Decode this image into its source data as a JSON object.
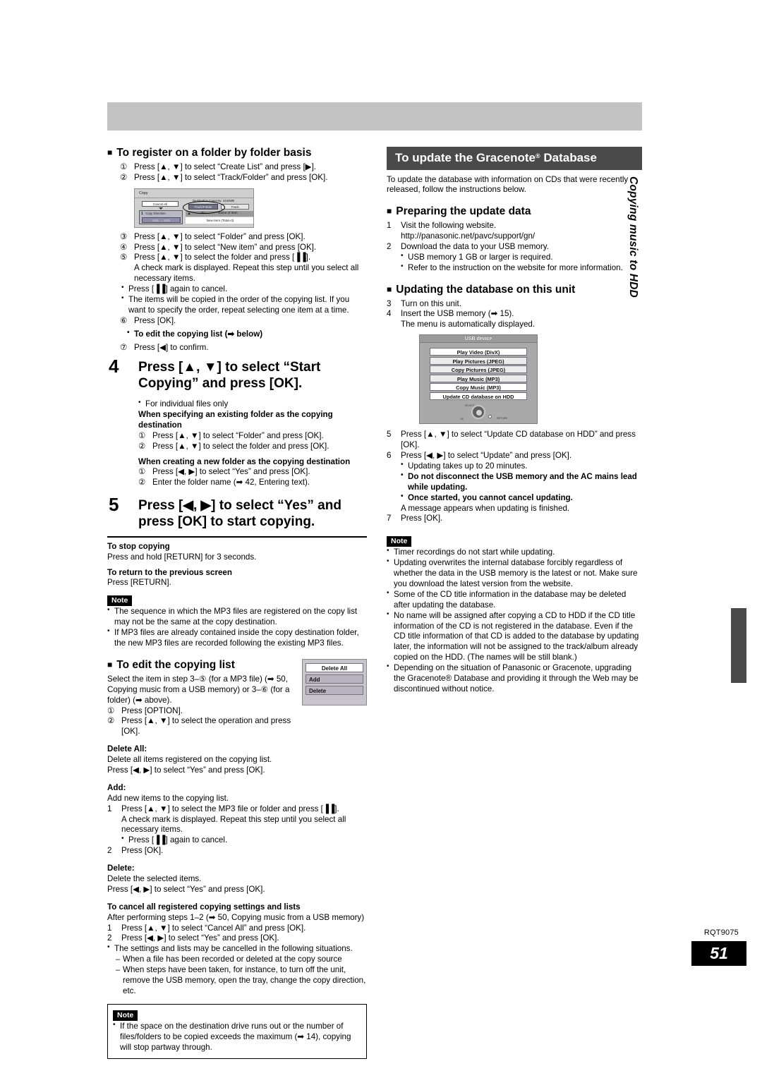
{
  "meta": {
    "doc_number": "RQT9075",
    "page_number": "51",
    "side_tab": "Copying music to HDD"
  },
  "left": {
    "s1_heading": "To register on a folder by folder basis",
    "s1_steps": [
      {
        "mark": "①",
        "text": "Press [▲, ▼] to select “Create List” and press [▶]."
      },
      {
        "mark": "②",
        "text": "Press [▲, ▼] to select “Track/Folder” and press [OK]."
      }
    ],
    "copy_screen": {
      "title": "Copy",
      "cancel_all": "Cancel All",
      "direction_num": "1",
      "direction_label": "Copy Direction",
      "direction_value": "USB → HDD",
      "capacity": "Destination Capacity: 4340MB",
      "tab_trackfolder": "Track/Folder",
      "tab_track": "Track",
      "col_no": "No.",
      "col_name": "Name of Item",
      "row_newitem": "New Item (Total=0)"
    },
    "s1_steps2": [
      {
        "mark": "③",
        "text": "Press [▲, ▼] to select “Folder” and press [OK]."
      },
      {
        "mark": "④",
        "text": "Press [▲, ▼] to select “New item” and press [OK]."
      },
      {
        "mark": "⑤",
        "text": "Press [▲, ▼] to select the folder and press [▐▐]."
      }
    ],
    "s1_note_a": "A check mark is displayed. Repeat this step until you select all necessary items.",
    "s1_bullets": [
      "Press [▐▐] again to cancel.",
      "The items will be copied in the order of the copying list. If you want to specify the order, repeat selecting one item at a time."
    ],
    "s1_step6": {
      "mark": "⑥",
      "text": "Press [OK]."
    },
    "s1_editlink": "To edit the copying list (➡ below)",
    "s1_step7": {
      "mark": "⑦",
      "text": "Press [◀] to confirm."
    },
    "step4_num": "4",
    "step4_text": "Press [▲, ▼] to select “Start Copying” and press [OK].",
    "step4_bullet": "For individual files only",
    "step4_sub1_title": "When specifying an existing folder as the copying destination",
    "step4_sub1_items": [
      {
        "mark": "①",
        "text": "Press [▲, ▼] to select “Folder” and press [OK]."
      },
      {
        "mark": "②",
        "text": "Press [▲, ▼] to select the folder and press [OK]."
      }
    ],
    "step4_sub2_title": "When creating a new folder as the copying destination",
    "step4_sub2_items": [
      {
        "mark": "①",
        "text": "Press [◀, ▶] to select “Yes” and press [OK]."
      },
      {
        "mark": "②",
        "text": "Enter the folder name (➡ 42, Entering text)."
      }
    ],
    "step5_num": "5",
    "step5_text": "Press [◀, ▶] to select “Yes” and press [OK] to start copying.",
    "stop_title": "To stop copying",
    "stop_text": "Press and hold [RETURN] for 3 seconds.",
    "return_title": "To return to the previous screen",
    "return_text": "Press [RETURN].",
    "note_label": "Note",
    "note_bullets": [
      "The sequence in which the MP3 files are registered on the copy list may not be the same at the copy destination.",
      "If MP3 files are already contained inside the copy destination folder, the new MP3 files are recorded following the existing MP3 files."
    ],
    "edit_heading": "To edit the copying list",
    "edit_intro": "Select the item in step 3–⑤ (for a MP3 file) (➡ 50, Copying music from a USB memory) or 3–⑥ (for a folder) (➡ above).",
    "edit_steps": [
      {
        "mark": "①",
        "text": "Press [OPTION]."
      },
      {
        "mark": "②",
        "text": "Press [▲, ▼] to select the operation and press [OK]."
      }
    ],
    "option_menu": {
      "selected": "Delete All",
      "items": [
        "Add",
        "Delete"
      ]
    },
    "deleteall_title": "Delete All:",
    "deleteall_lines": [
      "Delete all items registered on the copying list.",
      "Press [◀, ▶] to select “Yes” and press [OK]."
    ],
    "add_title": "Add:",
    "add_intro": "Add new items to the copying list.",
    "add_steps": [
      {
        "mark": "1",
        "text": "Press [▲, ▼] to select the MP3 file or folder and press [▐▐]."
      },
      {
        "mark": "2",
        "text": "Press [OK]."
      }
    ],
    "add_note": "A check mark is displayed. Repeat this step until you select all necessary items.",
    "add_bullet": "Press [▐▐] again to cancel.",
    "delete_title": "Delete:",
    "delete_lines": [
      "Delete the selected items.",
      "Press [◀, ▶] to select “Yes” and press [OK]."
    ],
    "cancel_title": "To cancel all registered copying settings and lists",
    "cancel_intro": "After performing steps 1–2 (➡ 50, Copying music from a USB memory)",
    "cancel_steps": [
      {
        "mark": "1",
        "text": "Press [▲, ▼] to select “Cancel All” and press [OK]."
      },
      {
        "mark": "2",
        "text": "Press [◀, ▶] to select “Yes” and press [OK]."
      }
    ],
    "cancel_bullet": "The settings and lists may be cancelled in the following situations.",
    "cancel_dashes": [
      "When a file has been recorded or deleted at the copy source",
      "When steps have been taken, for instance, to turn off the unit, remove the USB memory, open the tray, change the copy direction, etc."
    ],
    "note2_label": "Note",
    "note2_bullet": "If the space on the destination drive runs out or the number of files/folders to be copied exceeds the maximum (➡ 14), copying will stop partway through."
  },
  "right": {
    "banner_title": "To update the Gracenote",
    "banner_sup": "®",
    "banner_title2": " Database",
    "intro": "To update the database with information on CDs that were recently released, follow the instructions below.",
    "prep_heading": "Preparing the update data",
    "prep_steps": [
      {
        "mark": "1",
        "text": "Visit the following website."
      },
      {
        "mark": "",
        "text": "http://panasonic.net/pavc/support/gn/"
      },
      {
        "mark": "2",
        "text": "Download the data to your USB memory."
      }
    ],
    "prep_bullets": [
      "USB memory 1 GB or larger is required.",
      "Refer to the instruction on the website for more information."
    ],
    "upd_heading": "Updating the database on this unit",
    "upd_steps": [
      {
        "mark": "3",
        "text": "Turn on this unit."
      },
      {
        "mark": "4",
        "text": "Insert the USB memory (➡ 15)."
      },
      {
        "mark": "",
        "text": "The menu is automatically displayed."
      }
    ],
    "usb_menu": {
      "title": "USB device",
      "items": [
        "Play Video (DivX)",
        "Play Pictures (JPEG)",
        "Copy Pictures (JPEG)",
        "Play Music (MP3)",
        "Copy Music (MP3)",
        "Update CD database on HDD"
      ],
      "pad_select": "SELECT",
      "pad_ok": "OK",
      "pad_return": "RETURN"
    },
    "upd_steps2": [
      {
        "mark": "5",
        "text": "Press [▲, ▼] to select “Update CD database on HDD” and press [OK]."
      },
      {
        "mark": "6",
        "text": "Press [◀, ▶] to select “Update” and press [OK]."
      }
    ],
    "upd_bullets": [
      {
        "text": "Updating takes up to 20 minutes.",
        "bold": false
      },
      {
        "text": "Do not disconnect the USB memory and the AC mains lead while updating.",
        "bold": true
      },
      {
        "text": "Once started, you cannot cancel updating.",
        "bold": true
      }
    ],
    "upd_after": "A message appears when updating is finished.",
    "upd_step7": {
      "mark": "7",
      "text": "Press [OK]."
    },
    "note_label": "Note",
    "note_bullets": [
      "Timer recordings do not start while updating.",
      "Updating overwrites the internal database forcibly regardless of whether the data in the USB memory is the latest or not. Make sure you download the latest version from the website.",
      "Some of the CD title information in the database may be deleted after updating the database.",
      "No name will be assigned after copying a CD to HDD if the CD title information of the CD is not registered in the database. Even if the CD title information of that CD is added to the database by updating later, the information will not be assigned to the track/album already copied on the HDD. (The names will be still blank.)",
      "Depending on the situation of Panasonic or Gracenote, upgrading the Gracenote® Database and providing it through the Web may be discontinued without notice."
    ]
  }
}
